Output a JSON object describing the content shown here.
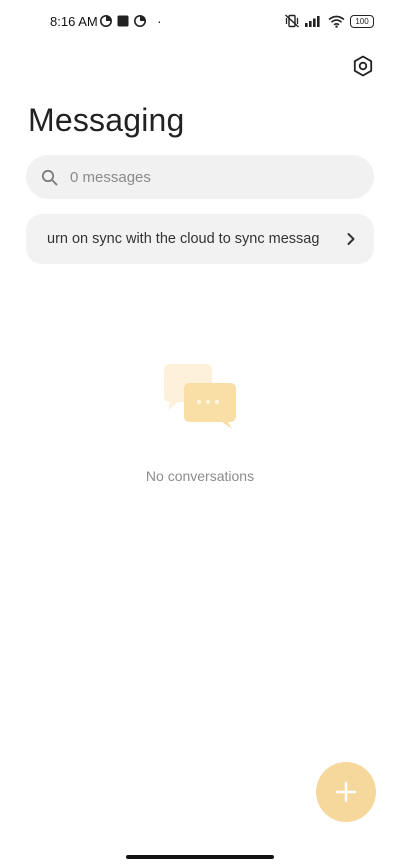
{
  "status_bar": {
    "time": "8:16 AM",
    "battery": "100",
    "dot": "·"
  },
  "header": {
    "title": "Messaging"
  },
  "search": {
    "placeholder": "0 messages"
  },
  "sync_banner": {
    "text": "urn on sync with the cloud to sync messag"
  },
  "empty_state": {
    "text": "No conversations"
  },
  "colors": {
    "accent": "#f6d89c",
    "illustration_back": "#fdf1dc",
    "illustration_front": "#f9dfa6",
    "surface": "#f1f1f1"
  },
  "icons": {
    "settings": "hexagon-settings-icon",
    "search": "search-icon",
    "chevron": "chevron-right-icon",
    "fab": "plus-icon"
  }
}
